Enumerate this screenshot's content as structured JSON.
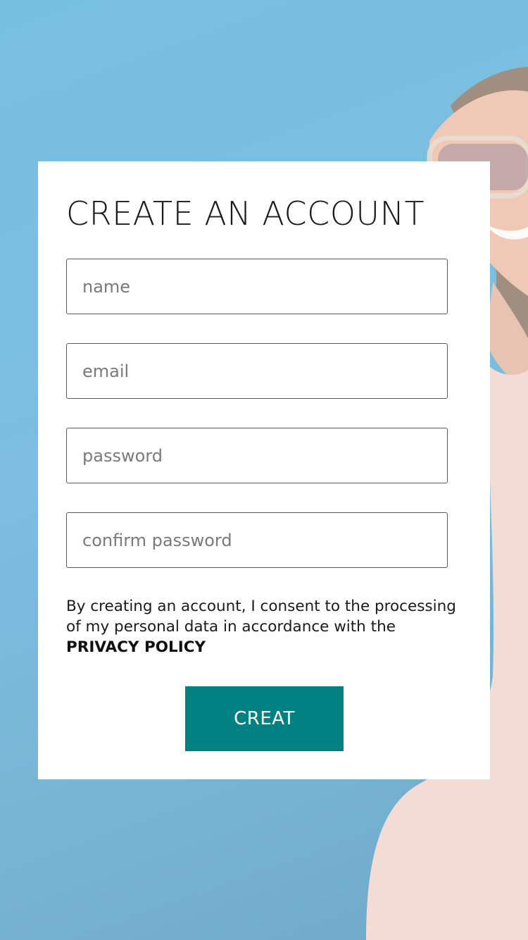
{
  "form": {
    "title": "CREATE AN ACCOUNT",
    "fields": [
      {
        "placeholder": "name",
        "value": ""
      },
      {
        "placeholder": "email",
        "value": ""
      },
      {
        "placeholder": "password",
        "value": ""
      },
      {
        "placeholder": "confirm password",
        "value": ""
      }
    ],
    "consent_text": "By creating an account, I consent to the processing of my personal data in accordance with the ",
    "privacy_link": "PRIVACY POLICY",
    "submit_label": "CREAT"
  },
  "colors": {
    "accent": "#008080",
    "background": "#7cbde0",
    "card": "#ffffff"
  }
}
